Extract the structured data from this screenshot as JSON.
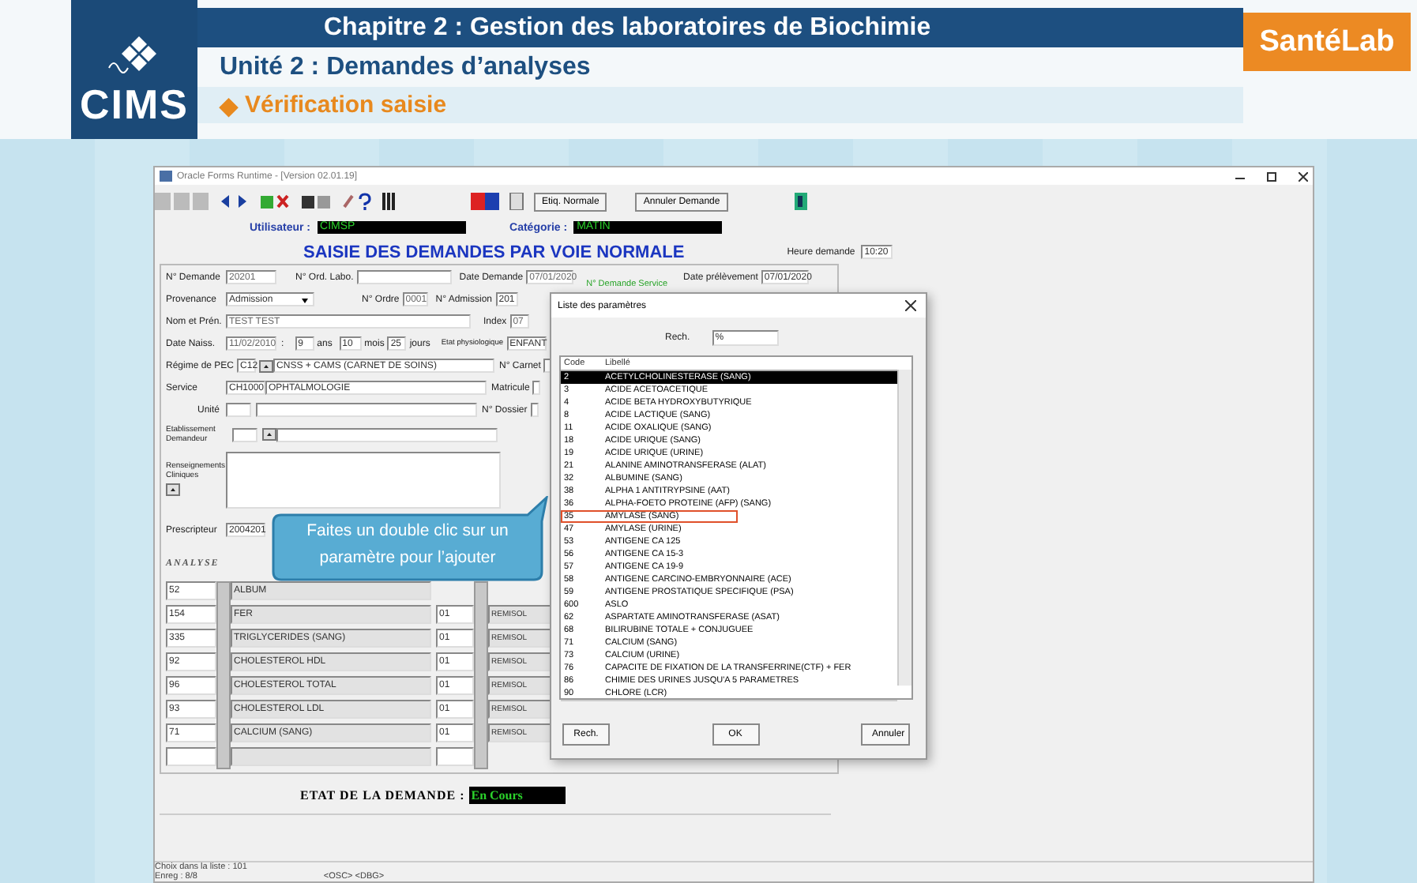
{
  "header": {
    "logo": "CIMS",
    "chapter": "Chapitre 2 : Gestion des laboratoires de Biochimie",
    "unit": "Unité 2 : Demandes d’analyses",
    "section_bullet": "◆",
    "section": "Vérification saisie",
    "brand": "SantéLab"
  },
  "window": {
    "title": "Oracle Forms Runtime - [Version 02.01.19]",
    "toolbar_buttons": [
      "Etiq. Normale",
      "Annuler Demande"
    ]
  },
  "user": {
    "label": "Utilisateur :",
    "value": "CIMSP"
  },
  "category": {
    "label": "Catégorie :",
    "value": "MATIN"
  },
  "form": {
    "title": "SAISIE DES DEMANDES PAR VOIE NORMALE",
    "heure": {
      "label": "Heure demande",
      "value": "10:20"
    },
    "n_demande": {
      "label": "N° Demande",
      "value": "20201"
    },
    "n_ord_labo": {
      "label": "N° Ord. Labo."
    },
    "date_demande": {
      "label": "Date Demande",
      "value": "07/01/2020"
    },
    "n_demande_service": {
      "label": "N° Demande Service"
    },
    "date_prelevement": {
      "label": "Date prélèvement",
      "value": "07/01/2020"
    },
    "provenance": {
      "label": "Provenance",
      "value": "Admission"
    },
    "n_ordre": {
      "label": "N° Ordre",
      "value": "0001"
    },
    "n_admission": {
      "label": "N° Admission",
      "value": "201"
    },
    "nom": {
      "label": "Nom et Prén.",
      "value": "TEST TEST"
    },
    "index": {
      "label": "Index",
      "value": "07"
    },
    "date_naiss": {
      "label": "Date Naiss.",
      "value": "11/02/2010",
      "sep": ":",
      "years": "9",
      "years_unit": "ans",
      "months": "10",
      "months_unit": "mois",
      "days": "25",
      "days_unit": "jours"
    },
    "etat_physio": {
      "label": "Etat physiologique",
      "value": "ENFANT"
    },
    "regime": {
      "label": "Régime de PEC",
      "code": "C12",
      "value": "CNSS + CAMS (CARNET DE SOINS)"
    },
    "n_carnet": {
      "label": "N° Carnet"
    },
    "service": {
      "label": "Service",
      "code": "CH1000",
      "value": "OPHTALMOLOGIE"
    },
    "matricule": {
      "label": "Matricule"
    },
    "unite": {
      "label": "Unité"
    },
    "n_dossier": {
      "label": "N° Dossier"
    },
    "etablissement": {
      "label": "Etablissement Demandeur"
    },
    "renseignements": {
      "label": "Renseignements Cliniques"
    },
    "prescripteur": {
      "label": "Prescripteur",
      "value": "2004201"
    },
    "analyse_title": "ANALYSE",
    "analyses": [
      {
        "code": "52",
        "label": "ALBUM"
      },
      {
        "code": "154",
        "label": "FER",
        "qty": "01",
        "supplier": "REMISOL"
      },
      {
        "code": "335",
        "label": "TRIGLYCERIDES (SANG)",
        "qty": "01",
        "supplier": "REMISOL"
      },
      {
        "code": "92",
        "label": "CHOLESTEROL HDL",
        "qty": "01",
        "supplier": "REMISOL"
      },
      {
        "code": "96",
        "label": "CHOLESTEROL TOTAL",
        "qty": "01",
        "supplier": "REMISOL"
      },
      {
        "code": "93",
        "label": "CHOLESTEROL LDL",
        "qty": "01",
        "supplier": "REMISOL"
      },
      {
        "code": "71",
        "label": "CALCIUM (SANG)",
        "qty": "01",
        "supplier": "REMISOL"
      }
    ],
    "etat": {
      "label": "ETAT DE LA DEMANDE :",
      "value": "En Cours"
    }
  },
  "status_bar": {
    "message": "Choix dans la liste : 101",
    "record": "Enreg : 8/8",
    "flags": "<OSC> <DBG>"
  },
  "callout": "Faites un double clic sur un paramètre pour l’ajouter",
  "dialog": {
    "title": "Liste des paramètres",
    "search_label": "Rech.",
    "search_value": "%",
    "columns": [
      "Code",
      "Libellé"
    ],
    "rows": [
      {
        "code": "2",
        "label": "ACETYLCHOLINESTERASE (SANG)",
        "selected": true,
        "highlighted": false
      },
      {
        "code": "3",
        "label": "ACIDE ACETOACETIQUE",
        "selected": false,
        "highlighted": false
      },
      {
        "code": "4",
        "label": "ACIDE BETA HYDROXYBUTYRIQUE",
        "selected": false,
        "highlighted": false
      },
      {
        "code": "8",
        "label": "ACIDE LACTIQUE (SANG)",
        "selected": false,
        "highlighted": false
      },
      {
        "code": "11",
        "label": "ACIDE OXALIQUE (SANG)",
        "selected": false,
        "highlighted": false
      },
      {
        "code": "18",
        "label": "ACIDE URIQUE (SANG)",
        "selected": false,
        "highlighted": false
      },
      {
        "code": "19",
        "label": "ACIDE URIQUE (URINE)",
        "selected": false,
        "highlighted": false
      },
      {
        "code": "21",
        "label": "ALANINE AMINOTRANSFERASE (ALAT)",
        "selected": false,
        "highlighted": false
      },
      {
        "code": "32",
        "label": "ALBUMINE (SANG)",
        "selected": false,
        "highlighted": false
      },
      {
        "code": "38",
        "label": "ALPHA 1 ANTITRYPSINE (AAT)",
        "selected": false,
        "highlighted": false
      },
      {
        "code": "36",
        "label": "ALPHA-FOETO PROTEINE (AFP) (SANG)",
        "selected": false,
        "highlighted": false
      },
      {
        "code": "35",
        "label": "AMYLASE (SANG)",
        "selected": false,
        "highlighted": true
      },
      {
        "code": "47",
        "label": "AMYLASE (URINE)",
        "selected": false,
        "highlighted": false
      },
      {
        "code": "53",
        "label": "ANTIGENE CA 125",
        "selected": false,
        "highlighted": false
      },
      {
        "code": "56",
        "label": "ANTIGENE CA 15-3",
        "selected": false,
        "highlighted": false
      },
      {
        "code": "57",
        "label": "ANTIGENE CA 19-9",
        "selected": false,
        "highlighted": false
      },
      {
        "code": "58",
        "label": "ANTIGENE CARCINO-EMBRYONNAIRE (ACE)",
        "selected": false,
        "highlighted": false
      },
      {
        "code": "59",
        "label": "ANTIGENE PROSTATIQUE SPECIFIQUE (PSA)",
        "selected": false,
        "highlighted": false
      },
      {
        "code": "600",
        "label": "ASLO",
        "selected": false,
        "highlighted": false
      },
      {
        "code": "62",
        "label": "ASPARTATE AMINOTRANSFERASE (ASAT)",
        "selected": false,
        "highlighted": false
      },
      {
        "code": "68",
        "label": "BILIRUBINE TOTALE + CONJUGUEE",
        "selected": false,
        "highlighted": false
      },
      {
        "code": "71",
        "label": "CALCIUM (SANG)",
        "selected": false,
        "highlighted": false
      },
      {
        "code": "73",
        "label": "CALCIUM (URINE)",
        "selected": false,
        "highlighted": false
      },
      {
        "code": "76",
        "label": "CAPACITE DE FIXATION DE LA TRANSFERRINE(CTF) + FER",
        "selected": false,
        "highlighted": false
      },
      {
        "code": "86",
        "label": "CHIMIE DES URINES JUSQU'A 5 PARAMETRES",
        "selected": false,
        "highlighted": false
      },
      {
        "code": "90",
        "label": "CHLORE (LCR)",
        "selected": false,
        "highlighted": false
      }
    ],
    "buttons": [
      "Rech.",
      "OK",
      "Annuler"
    ]
  }
}
